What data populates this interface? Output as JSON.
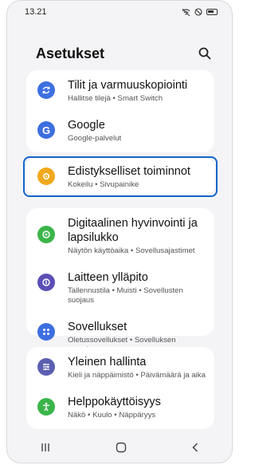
{
  "status": {
    "time": "13.21"
  },
  "header": {
    "title": "Asetukset"
  },
  "items": [
    {
      "label": "Tilit ja varmuuskopiointi",
      "sub": "Hallitse tilejä • Smart Switch",
      "color": "#3d6fe0"
    },
    {
      "label": "Google",
      "sub": "Google-palvelut",
      "color": "#3d6fe0"
    },
    {
      "label": "Edistykselliset toiminnot",
      "sub": "Kokeilu • Sivupainike",
      "color": "#f0a81c"
    },
    {
      "label": "Digitaalinen hyvinvointi ja lapsilukko",
      "sub": "Näytön käyttöaika • Sovellusajastimet",
      "color": "#3bb54a"
    },
    {
      "label": "Laitteen ylläpito",
      "sub": "Tallennustila • Muisti • Sovellusten suojaus",
      "color": "#5b4fb6"
    },
    {
      "label": "Sovellukset",
      "sub": "Oletussovellukset • Sovelluksen asetukset",
      "color": "#3d6fe0"
    },
    {
      "label": "Yleinen hallinta",
      "sub": "Kieli ja näppäimistö • Päivämäärä ja aika",
      "color": "#5b5fb0"
    },
    {
      "label": "Helppokäyttöisyys",
      "sub": "Näkö • Kuulo • Näppäryys",
      "color": "#3bb54a"
    }
  ]
}
